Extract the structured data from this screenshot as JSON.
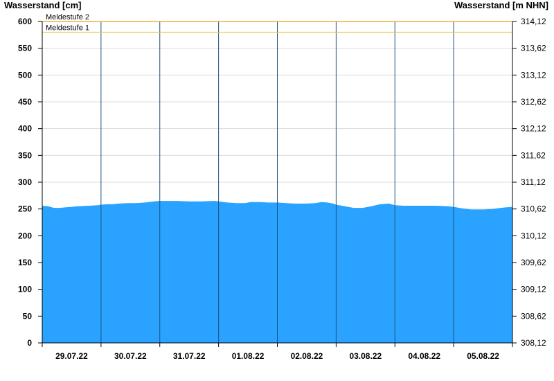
{
  "chart_data": {
    "type": "area",
    "y_left_label": "Wasserstand [cm]",
    "y_right_label": "Wasserstand [m NHN]",
    "ylim": [
      0,
      600
    ],
    "y_left_ticks": [
      "0",
      "50",
      "100",
      "150",
      "200",
      "250",
      "300",
      "350",
      "400",
      "450",
      "500",
      "550",
      "600"
    ],
    "y_right_ticks": [
      "308,12",
      "308,62",
      "309,12",
      "309,62",
      "310,12",
      "310,62",
      "311,12",
      "311,62",
      "312,12",
      "312,62",
      "313,12",
      "313,62",
      "314,12"
    ],
    "x_labels": [
      "29.07.22",
      "30.07.22",
      "31.07.22",
      "01.08.22",
      "02.08.22",
      "03.08.22",
      "04.08.22",
      "05.08.22"
    ],
    "x_range_days": 8,
    "fill_color": "#29a3ff",
    "thresholds": [
      {
        "name": "Meldestufe 2",
        "value": 600,
        "color": "#e8a020"
      },
      {
        "name": "Meldestufe 1",
        "value": 580,
        "color": "#e8c860"
      }
    ],
    "series": [
      {
        "points": [
          [
            0.0,
            256
          ],
          [
            0.1,
            255
          ],
          [
            0.2,
            252
          ],
          [
            0.3,
            252
          ],
          [
            0.4,
            253
          ],
          [
            0.5,
            254
          ],
          [
            0.6,
            255
          ],
          [
            0.8,
            256
          ],
          [
            0.95,
            257
          ],
          [
            1.0,
            258
          ],
          [
            1.1,
            259
          ],
          [
            1.2,
            259
          ],
          [
            1.3,
            260
          ],
          [
            1.45,
            261
          ],
          [
            1.6,
            261
          ],
          [
            1.75,
            262
          ],
          [
            1.9,
            264
          ],
          [
            2.0,
            265
          ],
          [
            2.15,
            265
          ],
          [
            2.3,
            265
          ],
          [
            2.5,
            264
          ],
          [
            2.7,
            264
          ],
          [
            2.9,
            265
          ],
          [
            2.95,
            265
          ],
          [
            3.0,
            264
          ],
          [
            3.15,
            262
          ],
          [
            3.3,
            261
          ],
          [
            3.45,
            261
          ],
          [
            3.55,
            263
          ],
          [
            3.7,
            263
          ],
          [
            3.85,
            262
          ],
          [
            3.95,
            262
          ],
          [
            4.0,
            262
          ],
          [
            4.15,
            261
          ],
          [
            4.3,
            260
          ],
          [
            4.5,
            260
          ],
          [
            4.65,
            261
          ],
          [
            4.75,
            263
          ],
          [
            4.85,
            262
          ],
          [
            4.95,
            260
          ],
          [
            5.0,
            258
          ],
          [
            5.15,
            255
          ],
          [
            5.3,
            252
          ],
          [
            5.45,
            252
          ],
          [
            5.6,
            255
          ],
          [
            5.75,
            259
          ],
          [
            5.9,
            260
          ],
          [
            6.0,
            257
          ],
          [
            6.15,
            256
          ],
          [
            6.3,
            256
          ],
          [
            6.5,
            256
          ],
          [
            6.7,
            256
          ],
          [
            6.9,
            255
          ],
          [
            7.0,
            254
          ],
          [
            7.15,
            251
          ],
          [
            7.3,
            249
          ],
          [
            7.5,
            249
          ],
          [
            7.65,
            250
          ],
          [
            7.8,
            252
          ],
          [
            7.9,
            253
          ],
          [
            8.0,
            254
          ]
        ]
      }
    ]
  }
}
